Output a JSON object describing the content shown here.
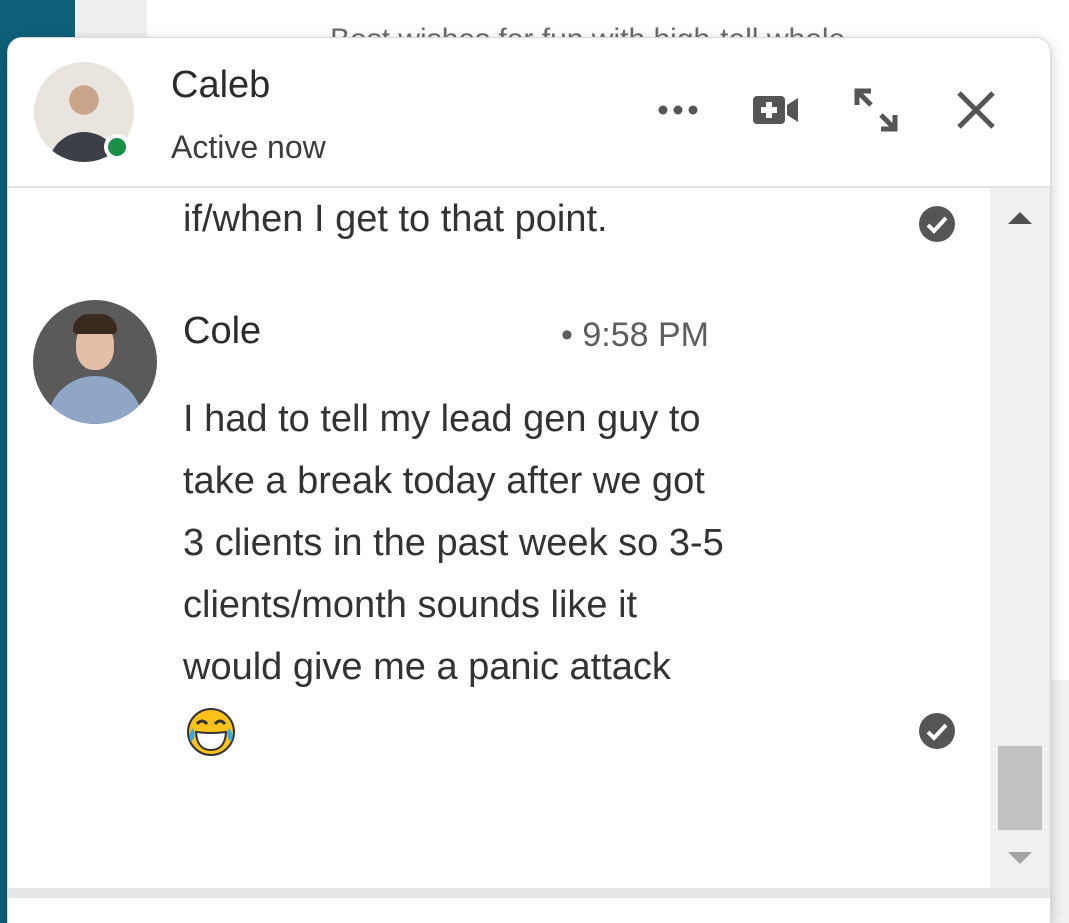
{
  "background": {
    "snippet": "Best wishes for fun with high-tell whole"
  },
  "header": {
    "name": "Caleb",
    "status": "Active now",
    "buttons": {
      "more": "more-options",
      "video": "video-call",
      "expand": "expand",
      "close": "close"
    }
  },
  "thread": {
    "previous_message_tail": "if/when I get to that point.",
    "message": {
      "sender": "Cole",
      "time": "• 9:58 PM",
      "lines": [
        "I had to tell my lead gen guy to",
        "take a break today after we got",
        "3 clients in the past week so 3-5",
        "clients/month sounds like it",
        "would give me a panic attack"
      ],
      "emoji": "face-with-tears-of-joy"
    }
  },
  "colors": {
    "presence": "#1a8f4a",
    "sidebar_blue": "#0e5f7a",
    "icon": "#555555"
  }
}
